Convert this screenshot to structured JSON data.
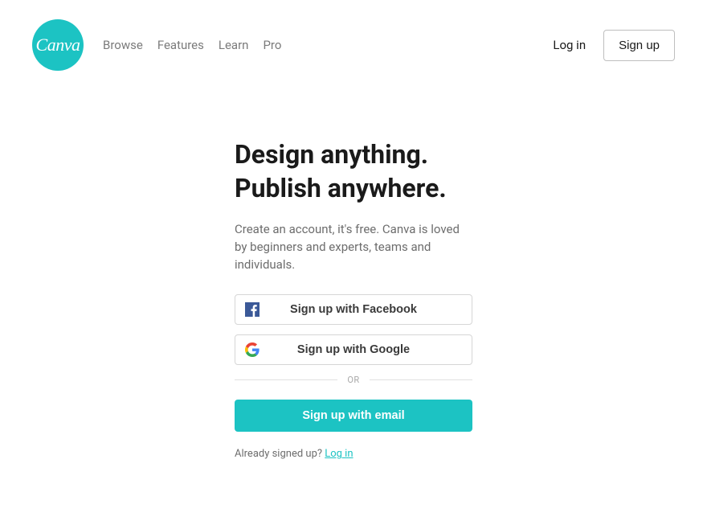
{
  "logo": {
    "text": "Canva"
  },
  "nav": {
    "browse": "Browse",
    "features": "Features",
    "learn": "Learn",
    "pro": "Pro"
  },
  "header": {
    "login": "Log in",
    "signup": "Sign up"
  },
  "main": {
    "headline_line1": "Design anything.",
    "headline_line2": "Publish anywhere.",
    "subtext": "Create an account, it's free. Canva is loved by beginners and experts, teams and individuals.",
    "facebook_btn": "Sign up with Facebook",
    "google_btn": "Sign up with Google",
    "divider": "OR",
    "email_btn": "Sign up with email",
    "already_text": "Already signed up? ",
    "already_link": "Log in"
  }
}
